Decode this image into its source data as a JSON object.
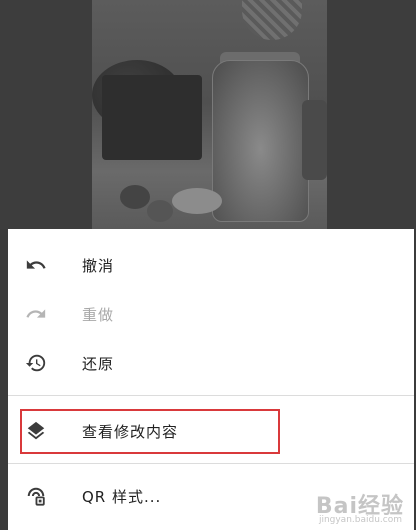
{
  "menu": {
    "items": [
      {
        "id": "undo",
        "label": "撤消",
        "icon": "undo-icon",
        "enabled": true
      },
      {
        "id": "redo",
        "label": "重做",
        "icon": "redo-icon",
        "enabled": false
      },
      {
        "id": "revert",
        "label": "还原",
        "icon": "history-icon",
        "enabled": true
      },
      {
        "id": "view-edits",
        "label": "查看修改内容",
        "icon": "layers-icon",
        "enabled": true,
        "highlighted": true
      },
      {
        "id": "qr-style",
        "label": "QR 样式...",
        "icon": "qr-style-icon",
        "enabled": true
      }
    ]
  },
  "colors": {
    "highlight_border": "#d9393b",
    "text": "#212121",
    "disabled_text": "#a8a8a8",
    "icon": "#3c3c3c",
    "disabled_icon": "#b5b5b5"
  },
  "watermark": {
    "main": "Bai经验",
    "sub": "jingyan.baidu.com"
  }
}
